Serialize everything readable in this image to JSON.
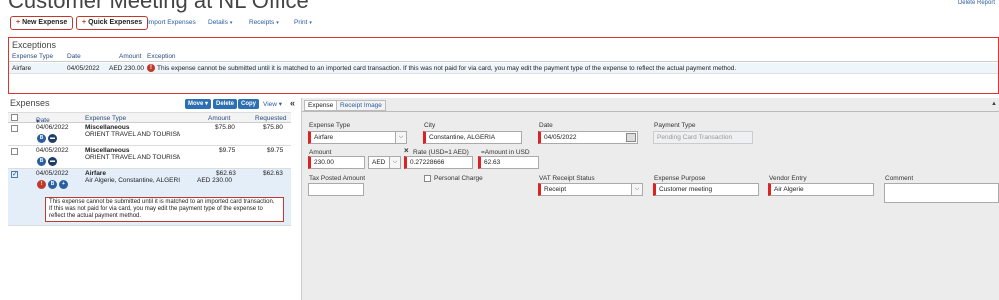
{
  "page": {
    "title": "Customer Meeting at NL Office",
    "top_right_link": "Delete Report"
  },
  "toolbar": {
    "new_expense": "New Expense",
    "quick_expenses": "Quick Expenses",
    "import_expenses": "Import Expenses",
    "details": "Details",
    "receipts": "Receipts",
    "print": "Print"
  },
  "exceptions": {
    "title": "Exceptions",
    "columns": [
      "Expense Type",
      "Date",
      "Amount",
      "Exception"
    ],
    "rows": [
      {
        "expense_type": "Airfare",
        "date": "04/05/2022",
        "amount": "AED 230.00",
        "message": "This expense cannot be submitted until it is matched to an imported card transaction. If this was not paid for via card, you may edit the payment type of the expense to reflect the actual payment method."
      }
    ]
  },
  "expenses": {
    "title": "Expenses",
    "buttons": {
      "move": "Move",
      "delete": "Delete",
      "copy": "Copy",
      "view": "View"
    },
    "collapse": "«",
    "columns": {
      "date": "Date",
      "expense_type": "Expense Type",
      "amount": "Amount",
      "requested": "Requested"
    },
    "rows": [
      {
        "date": "04/06/2022",
        "type": "Miscellaneous",
        "vendor": "ORIENT TRAVEL AND TOURISM",
        "amount": "$75.80",
        "requested": "$75.80",
        "checked": false
      },
      {
        "date": "04/05/2022",
        "type": "Miscellaneous",
        "vendor": "ORIENT TRAVEL AND TOURISM",
        "amount": "$9.75",
        "requested": "$9.75",
        "checked": false
      },
      {
        "date": "04/05/2022",
        "type": "Airfare",
        "vendor": "Air Algerie, Constantine, ALGERIA",
        "amount": "$62.63",
        "amount_secondary": "AED 230.00",
        "requested": "$62.63",
        "checked": true
      }
    ],
    "error_lines": [
      "This expense cannot be submitted until it is matched to an imported card transaction.",
      "If this was not paid for via card, you may edit the payment type of the expense to",
      "reflect the actual payment method."
    ]
  },
  "detail": {
    "tabs": [
      "Expense",
      "Receipt Image"
    ],
    "fields": {
      "expense_type_label": "Expense Type",
      "expense_type_value": "Airfare",
      "city_label": "City",
      "city_value": "Constantine, ALGERIA",
      "date_label": "Date",
      "date_value": "04/05/2022",
      "payment_type_label": "Payment Type",
      "payment_type_value": "Pending Card Transaction",
      "amount_label": "Amount",
      "amount_value": "230.00",
      "currency_value": "AED",
      "rate_label": "Rate (USD=1 AED)",
      "rate_value": "0.27228666",
      "amount_usd_label": "=Amount in USD",
      "amount_usd_value": "62.63",
      "tax_posted_label": "Tax Posted Amount",
      "tax_posted_value": "",
      "personal_charge_label": "Personal Charge",
      "vat_label": "VAT Receipt Status",
      "vat_value": "Receipt",
      "purpose_label": "Expense Purpose",
      "purpose_value": "Customer meeting",
      "vendor_label": "Vendor Entry",
      "vendor_value": "Air Algerie",
      "comment_label": "Comment",
      "comment_value": ""
    }
  },
  "colors": {
    "accent_red": "#c0392b",
    "link_blue": "#2a5d9f",
    "button_blue": "#2c6fb3",
    "selected_row": "#e3eef9"
  }
}
